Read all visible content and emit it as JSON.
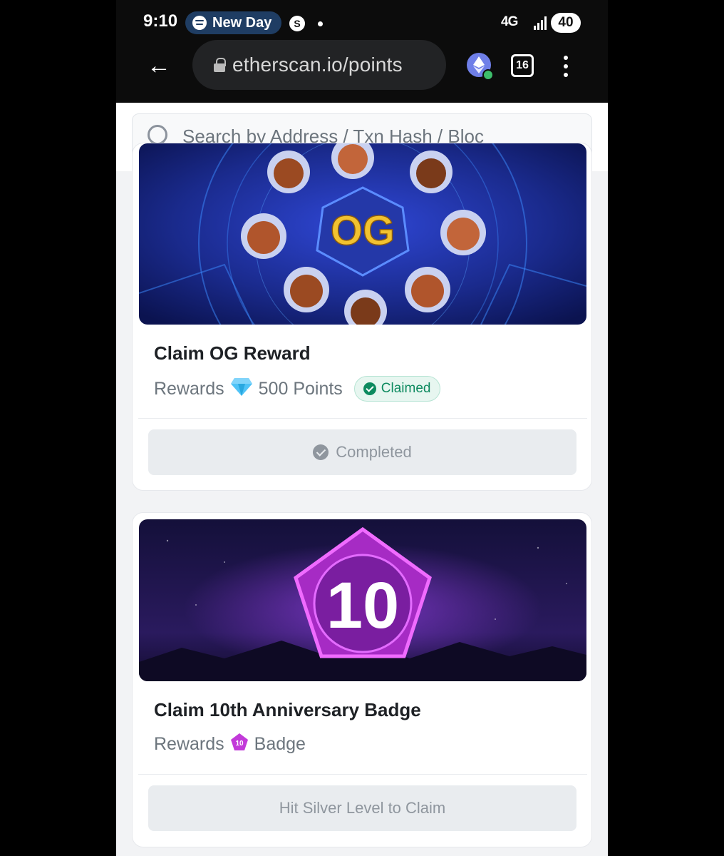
{
  "status_bar": {
    "time": "9:10",
    "media_label": "New Day",
    "network": "4G",
    "battery": "40"
  },
  "browser": {
    "url": "etherscan.io/points",
    "tab_count": "16"
  },
  "search": {
    "placeholder": "Search by Address / Txn Hash / Bloc"
  },
  "cards": [
    {
      "title": "Claim OG Reward",
      "rewards_label": "Rewards",
      "reward_value": "500 Points",
      "status_badge": "Claimed",
      "banner_text": "OG",
      "action_label": "Completed"
    },
    {
      "title": "Claim 10th Anniversary Badge",
      "rewards_label": "Rewards",
      "reward_value": "Badge",
      "banner_text": "10",
      "badge_icon_text": "10",
      "action_label": "Hit Silver Level to Claim"
    }
  ],
  "colors": {
    "accent_green": "#0d8a5f",
    "og_banner_bg": "#1a2a8c",
    "badge_purple": "#c23ad9"
  }
}
